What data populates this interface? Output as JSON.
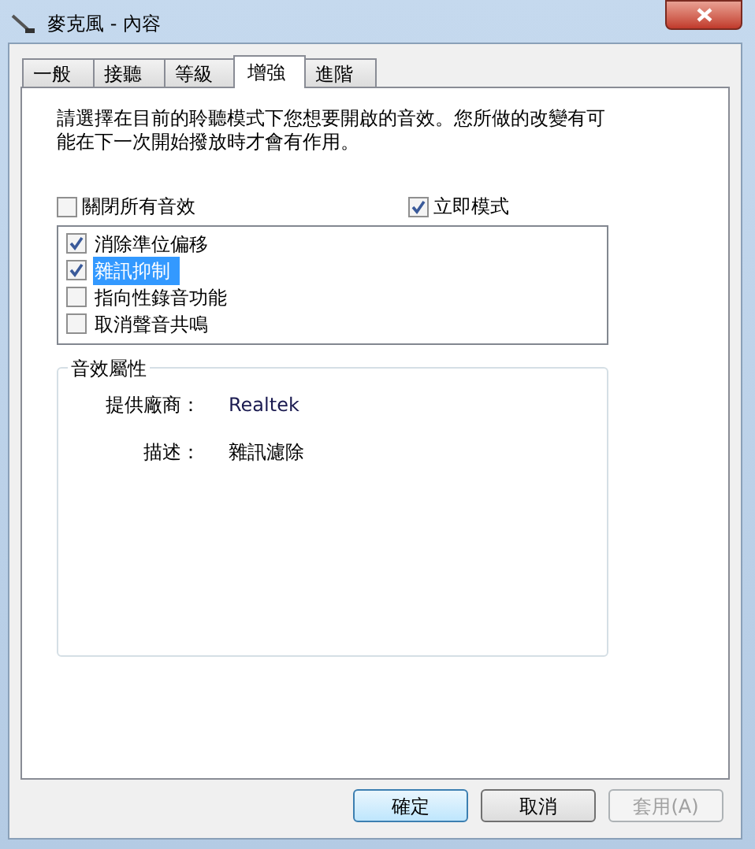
{
  "window": {
    "title": "麥克風 - 內容"
  },
  "tabs": [
    {
      "label": "一般",
      "selected": false
    },
    {
      "label": "接聽",
      "selected": false
    },
    {
      "label": "等級",
      "selected": false
    },
    {
      "label": "增強",
      "selected": true
    },
    {
      "label": "進階",
      "selected": false
    }
  ],
  "intro": "請選擇在目前的聆聽模式下您想要開啟的音效。您所做的改變有可能在下一次開始撥放時才會有作用。",
  "disable_all": {
    "label": "關閉所有音效",
    "checked": false
  },
  "immediate_mode": {
    "label": "立即模式",
    "checked": true
  },
  "effects": [
    {
      "label": "消除準位偏移",
      "checked": true,
      "selected": false
    },
    {
      "label": "雜訊抑制",
      "checked": true,
      "selected": true
    },
    {
      "label": "指向性錄音功能",
      "checked": false,
      "selected": false
    },
    {
      "label": "取消聲音共鳴",
      "checked": false,
      "selected": false
    }
  ],
  "properties": {
    "title": "音效屬性",
    "provider_label": "提供廠商：",
    "provider": "Realtek",
    "description_label": "描述：",
    "description": "雜訊濾除"
  },
  "buttons": [
    {
      "label": "確定",
      "default": true,
      "disabled": false
    },
    {
      "label": "取消",
      "default": false,
      "disabled": false
    },
    {
      "label": "套用(A)",
      "default": false,
      "disabled": true
    }
  ]
}
